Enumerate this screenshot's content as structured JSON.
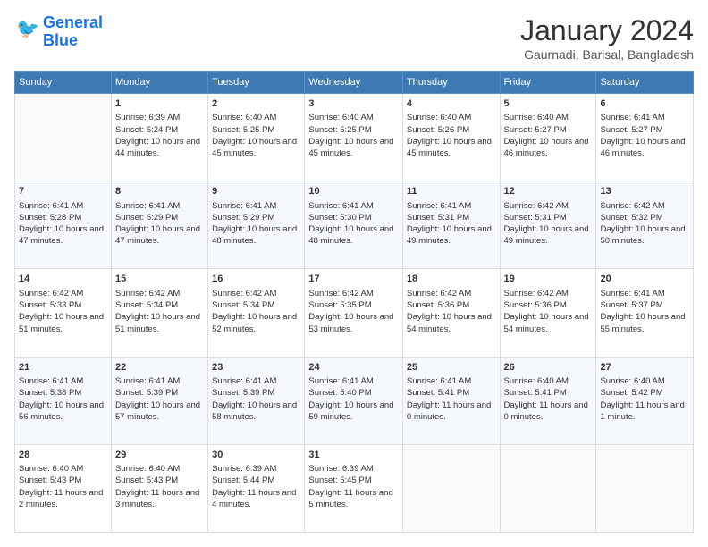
{
  "logo": {
    "line1": "General",
    "line2": "Blue"
  },
  "title": "January 2024",
  "location": "Gaurnadi, Barisal, Bangladesh",
  "days_header": [
    "Sunday",
    "Monday",
    "Tuesday",
    "Wednesday",
    "Thursday",
    "Friday",
    "Saturday"
  ],
  "weeks": [
    [
      {
        "day": "",
        "sunrise": "",
        "sunset": "",
        "daylight": ""
      },
      {
        "day": "1",
        "sunrise": "Sunrise: 6:39 AM",
        "sunset": "Sunset: 5:24 PM",
        "daylight": "Daylight: 10 hours and 44 minutes."
      },
      {
        "day": "2",
        "sunrise": "Sunrise: 6:40 AM",
        "sunset": "Sunset: 5:25 PM",
        "daylight": "Daylight: 10 hours and 45 minutes."
      },
      {
        "day": "3",
        "sunrise": "Sunrise: 6:40 AM",
        "sunset": "Sunset: 5:25 PM",
        "daylight": "Daylight: 10 hours and 45 minutes."
      },
      {
        "day": "4",
        "sunrise": "Sunrise: 6:40 AM",
        "sunset": "Sunset: 5:26 PM",
        "daylight": "Daylight: 10 hours and 45 minutes."
      },
      {
        "day": "5",
        "sunrise": "Sunrise: 6:40 AM",
        "sunset": "Sunset: 5:27 PM",
        "daylight": "Daylight: 10 hours and 46 minutes."
      },
      {
        "day": "6",
        "sunrise": "Sunrise: 6:41 AM",
        "sunset": "Sunset: 5:27 PM",
        "daylight": "Daylight: 10 hours and 46 minutes."
      }
    ],
    [
      {
        "day": "7",
        "sunrise": "Sunrise: 6:41 AM",
        "sunset": "Sunset: 5:28 PM",
        "daylight": "Daylight: 10 hours and 47 minutes."
      },
      {
        "day": "8",
        "sunrise": "Sunrise: 6:41 AM",
        "sunset": "Sunset: 5:29 PM",
        "daylight": "Daylight: 10 hours and 47 minutes."
      },
      {
        "day": "9",
        "sunrise": "Sunrise: 6:41 AM",
        "sunset": "Sunset: 5:29 PM",
        "daylight": "Daylight: 10 hours and 48 minutes."
      },
      {
        "day": "10",
        "sunrise": "Sunrise: 6:41 AM",
        "sunset": "Sunset: 5:30 PM",
        "daylight": "Daylight: 10 hours and 48 minutes."
      },
      {
        "day": "11",
        "sunrise": "Sunrise: 6:41 AM",
        "sunset": "Sunset: 5:31 PM",
        "daylight": "Daylight: 10 hours and 49 minutes."
      },
      {
        "day": "12",
        "sunrise": "Sunrise: 6:42 AM",
        "sunset": "Sunset: 5:31 PM",
        "daylight": "Daylight: 10 hours and 49 minutes."
      },
      {
        "day": "13",
        "sunrise": "Sunrise: 6:42 AM",
        "sunset": "Sunset: 5:32 PM",
        "daylight": "Daylight: 10 hours and 50 minutes."
      }
    ],
    [
      {
        "day": "14",
        "sunrise": "Sunrise: 6:42 AM",
        "sunset": "Sunset: 5:33 PM",
        "daylight": "Daylight: 10 hours and 51 minutes."
      },
      {
        "day": "15",
        "sunrise": "Sunrise: 6:42 AM",
        "sunset": "Sunset: 5:34 PM",
        "daylight": "Daylight: 10 hours and 51 minutes."
      },
      {
        "day": "16",
        "sunrise": "Sunrise: 6:42 AM",
        "sunset": "Sunset: 5:34 PM",
        "daylight": "Daylight: 10 hours and 52 minutes."
      },
      {
        "day": "17",
        "sunrise": "Sunrise: 6:42 AM",
        "sunset": "Sunset: 5:35 PM",
        "daylight": "Daylight: 10 hours and 53 minutes."
      },
      {
        "day": "18",
        "sunrise": "Sunrise: 6:42 AM",
        "sunset": "Sunset: 5:36 PM",
        "daylight": "Daylight: 10 hours and 54 minutes."
      },
      {
        "day": "19",
        "sunrise": "Sunrise: 6:42 AM",
        "sunset": "Sunset: 5:36 PM",
        "daylight": "Daylight: 10 hours and 54 minutes."
      },
      {
        "day": "20",
        "sunrise": "Sunrise: 6:41 AM",
        "sunset": "Sunset: 5:37 PM",
        "daylight": "Daylight: 10 hours and 55 minutes."
      }
    ],
    [
      {
        "day": "21",
        "sunrise": "Sunrise: 6:41 AM",
        "sunset": "Sunset: 5:38 PM",
        "daylight": "Daylight: 10 hours and 56 minutes."
      },
      {
        "day": "22",
        "sunrise": "Sunrise: 6:41 AM",
        "sunset": "Sunset: 5:39 PM",
        "daylight": "Daylight: 10 hours and 57 minutes."
      },
      {
        "day": "23",
        "sunrise": "Sunrise: 6:41 AM",
        "sunset": "Sunset: 5:39 PM",
        "daylight": "Daylight: 10 hours and 58 minutes."
      },
      {
        "day": "24",
        "sunrise": "Sunrise: 6:41 AM",
        "sunset": "Sunset: 5:40 PM",
        "daylight": "Daylight: 10 hours and 59 minutes."
      },
      {
        "day": "25",
        "sunrise": "Sunrise: 6:41 AM",
        "sunset": "Sunset: 5:41 PM",
        "daylight": "Daylight: 11 hours and 0 minutes."
      },
      {
        "day": "26",
        "sunrise": "Sunrise: 6:40 AM",
        "sunset": "Sunset: 5:41 PM",
        "daylight": "Daylight: 11 hours and 0 minutes."
      },
      {
        "day": "27",
        "sunrise": "Sunrise: 6:40 AM",
        "sunset": "Sunset: 5:42 PM",
        "daylight": "Daylight: 11 hours and 1 minute."
      }
    ],
    [
      {
        "day": "28",
        "sunrise": "Sunrise: 6:40 AM",
        "sunset": "Sunset: 5:43 PM",
        "daylight": "Daylight: 11 hours and 2 minutes."
      },
      {
        "day": "29",
        "sunrise": "Sunrise: 6:40 AM",
        "sunset": "Sunset: 5:43 PM",
        "daylight": "Daylight: 11 hours and 3 minutes."
      },
      {
        "day": "30",
        "sunrise": "Sunrise: 6:39 AM",
        "sunset": "Sunset: 5:44 PM",
        "daylight": "Daylight: 11 hours and 4 minutes."
      },
      {
        "day": "31",
        "sunrise": "Sunrise: 6:39 AM",
        "sunset": "Sunset: 5:45 PM",
        "daylight": "Daylight: 11 hours and 5 minutes."
      },
      {
        "day": "",
        "sunrise": "",
        "sunset": "",
        "daylight": ""
      },
      {
        "day": "",
        "sunrise": "",
        "sunset": "",
        "daylight": ""
      },
      {
        "day": "",
        "sunrise": "",
        "sunset": "",
        "daylight": ""
      }
    ]
  ]
}
